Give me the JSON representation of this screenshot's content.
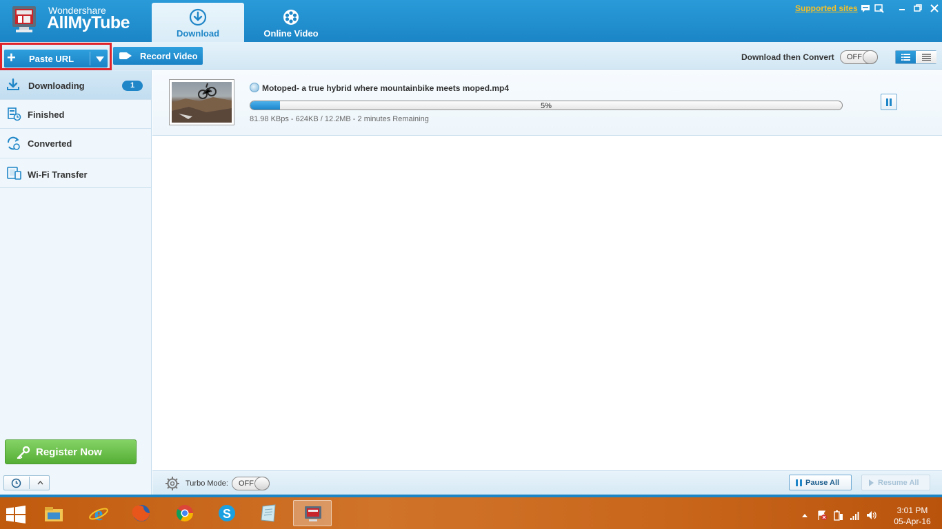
{
  "app": {
    "brand_small": "Wondershare",
    "brand_big": "AllMyTube",
    "tabs": [
      {
        "label": "Download",
        "icon": "download-circle-icon",
        "active": true
      },
      {
        "label": "Online Video",
        "icon": "film-reel-icon",
        "active": false
      }
    ],
    "supported_sites": "Supported sites",
    "window_controls": [
      "chat-icon",
      "settings-icon",
      "minimize-icon",
      "maximize-icon",
      "close-icon"
    ]
  },
  "toolbar": {
    "paste_url": "Paste URL",
    "record_video": "Record Video",
    "download_then_convert": "Download then Convert",
    "toggle_state": "OFF"
  },
  "sidebar": {
    "items": [
      {
        "label": "Downloading",
        "icon": "download-tray-icon",
        "badge": "1",
        "active": true
      },
      {
        "label": "Finished",
        "icon": "finished-film-icon"
      },
      {
        "label": "Converted",
        "icon": "converted-refresh-icon"
      },
      {
        "label": "Wi-Fi Transfer",
        "icon": "wifi-transfer-icon"
      }
    ],
    "register": "Register Now"
  },
  "download": {
    "file_name": "Motoped-  a true hybrid where mountainbike meets moped.mp4",
    "percent_label": "5%",
    "progress": 0.05,
    "stats": "81.98 KBps - 624KB / 12.2MB - 2 minutes Remaining"
  },
  "bottom": {
    "turbo_label": "Turbo Mode:",
    "turbo_state": "OFF",
    "pause_all": "Pause All",
    "resume_all": "Resume All"
  },
  "taskbar": {
    "apps": [
      "file-explorer-icon",
      "internet-explorer-icon",
      "firefox-icon",
      "chrome-icon",
      "skype-icon",
      "notepad-icon",
      "allmytube-icon"
    ],
    "time": "3:01 PM",
    "date": "05-Apr-16"
  },
  "colors": {
    "accent": "#1f86c7",
    "highlight_frame": "#e0232a",
    "register_green": "#55ae35",
    "supported_sites": "#f5c026",
    "taskbar": "#c9671c"
  }
}
